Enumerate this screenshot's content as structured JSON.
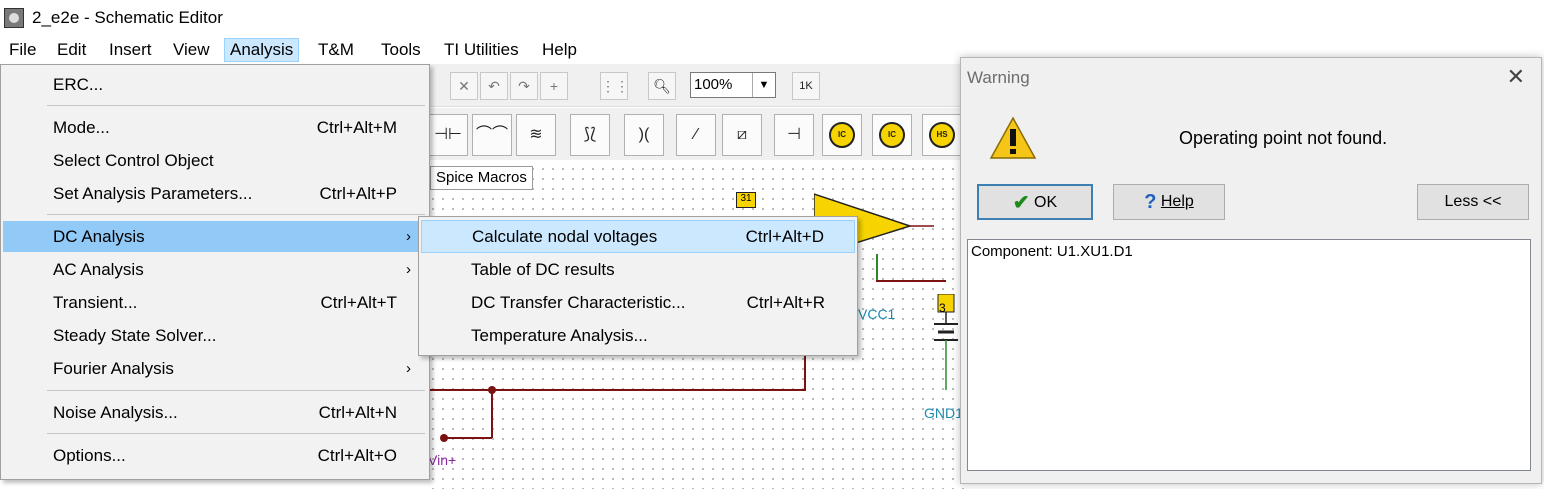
{
  "window": {
    "title": "2_e2e - Schematic Editor"
  },
  "menubar": [
    "File",
    "Edit",
    "Insert",
    "View",
    "Analysis",
    "T&M",
    "Tools",
    "TI Utilities",
    "Help"
  ],
  "analysis_menu": {
    "items": [
      {
        "label": "ERC...",
        "shortcut": ""
      },
      {
        "label": "Mode...",
        "shortcut": "Ctrl+Alt+M"
      },
      {
        "label": "Select Control Object",
        "shortcut": ""
      },
      {
        "label": "Set Analysis Parameters...",
        "shortcut": "Ctrl+Alt+P"
      },
      {
        "label": "DC Analysis",
        "shortcut": ""
      },
      {
        "label": "AC Analysis",
        "shortcut": ""
      },
      {
        "label": "Transient...",
        "shortcut": "Ctrl+Alt+T"
      },
      {
        "label": "Steady State Solver...",
        "shortcut": ""
      },
      {
        "label": "Fourier Analysis",
        "shortcut": ""
      },
      {
        "label": "Noise Analysis...",
        "shortcut": "Ctrl+Alt+N"
      },
      {
        "label": "Options...",
        "shortcut": "Ctrl+Alt+O"
      }
    ],
    "highlighted": "DC Analysis"
  },
  "dc_submenu": {
    "items": [
      {
        "label": "Calculate nodal voltages",
        "shortcut": "Ctrl+Alt+D"
      },
      {
        "label": "Table of DC results",
        "shortcut": ""
      },
      {
        "label": "DC Transfer Characteristic...",
        "shortcut": "Ctrl+Alt+R"
      },
      {
        "label": "Temperature Analysis...",
        "shortcut": ""
      }
    ],
    "highlighted": "Calculate nodal voltages"
  },
  "toolbar": {
    "zoom": "100%",
    "tab": "Spice Macros"
  },
  "schematic": {
    "labels": [
      "VCC1",
      "GND1",
      "Vin+",
      "3",
      "31"
    ]
  },
  "dialog": {
    "title": "Warning",
    "message": "Operating point not found.",
    "buttons": {
      "ok": "OK",
      "help": "Help",
      "less": "Less <<"
    },
    "details": "Component: U1.XU1.D1"
  },
  "colors": {
    "menu_highlight": "#91c9f7",
    "submenu_highlight": "#cce8ff",
    "wire": "#7a1212",
    "opamp": "#f7d400"
  }
}
